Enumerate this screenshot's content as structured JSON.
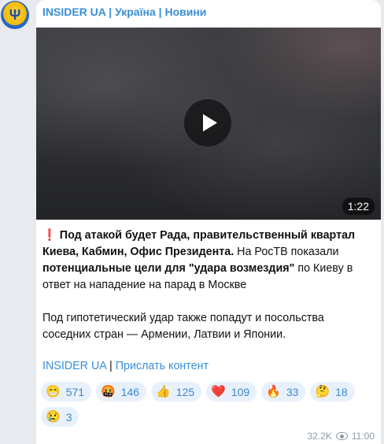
{
  "channel": {
    "name": "INSIDER UA | Україна | Новини",
    "avatar_icon": "ukraine-trident-icon"
  },
  "video": {
    "duration": "1:22",
    "play_icon": "play-icon"
  },
  "post": {
    "exclamation": "❗",
    "p1_bold": "Под атакой будет Рада, правительственный квартал Киева, Кабмин, Офис Президента.",
    "p1_a": " На РосТВ показали ",
    "p1_bold2": "потенциальные цели для \"удара возмездия\"",
    "p1_b": " по Киеву в ответ на нападение на парад в Москве",
    "p2": "Под гипотетический удар также попадут и посольства соседних стран — Армении, Латвии и Японии."
  },
  "links": {
    "channel_link": "INSIDER UA",
    "separator": " | ",
    "submit_link": "Прислать контент"
  },
  "reactions": [
    {
      "emoji": "😁",
      "count": "571",
      "name": "reaction-grin"
    },
    {
      "emoji": "🤬",
      "count": "146",
      "name": "reaction-cursing"
    },
    {
      "emoji": "👍",
      "count": "125",
      "name": "reaction-thumbs-up"
    },
    {
      "emoji": "❤️",
      "count": "109",
      "name": "reaction-heart"
    },
    {
      "emoji": "🔥",
      "count": "33",
      "name": "reaction-fire"
    },
    {
      "emoji": "🤔",
      "count": "18",
      "name": "reaction-thinking"
    },
    {
      "emoji": "😢",
      "count": "3",
      "name": "reaction-crying"
    }
  ],
  "footer": {
    "views": "32.2K",
    "time": "11:00",
    "views_icon": "eye-icon"
  },
  "colors": {
    "link": "#3a8ed6",
    "reaction_bg": "#e8f1fb",
    "chat_bg": "#e7ebf0"
  }
}
